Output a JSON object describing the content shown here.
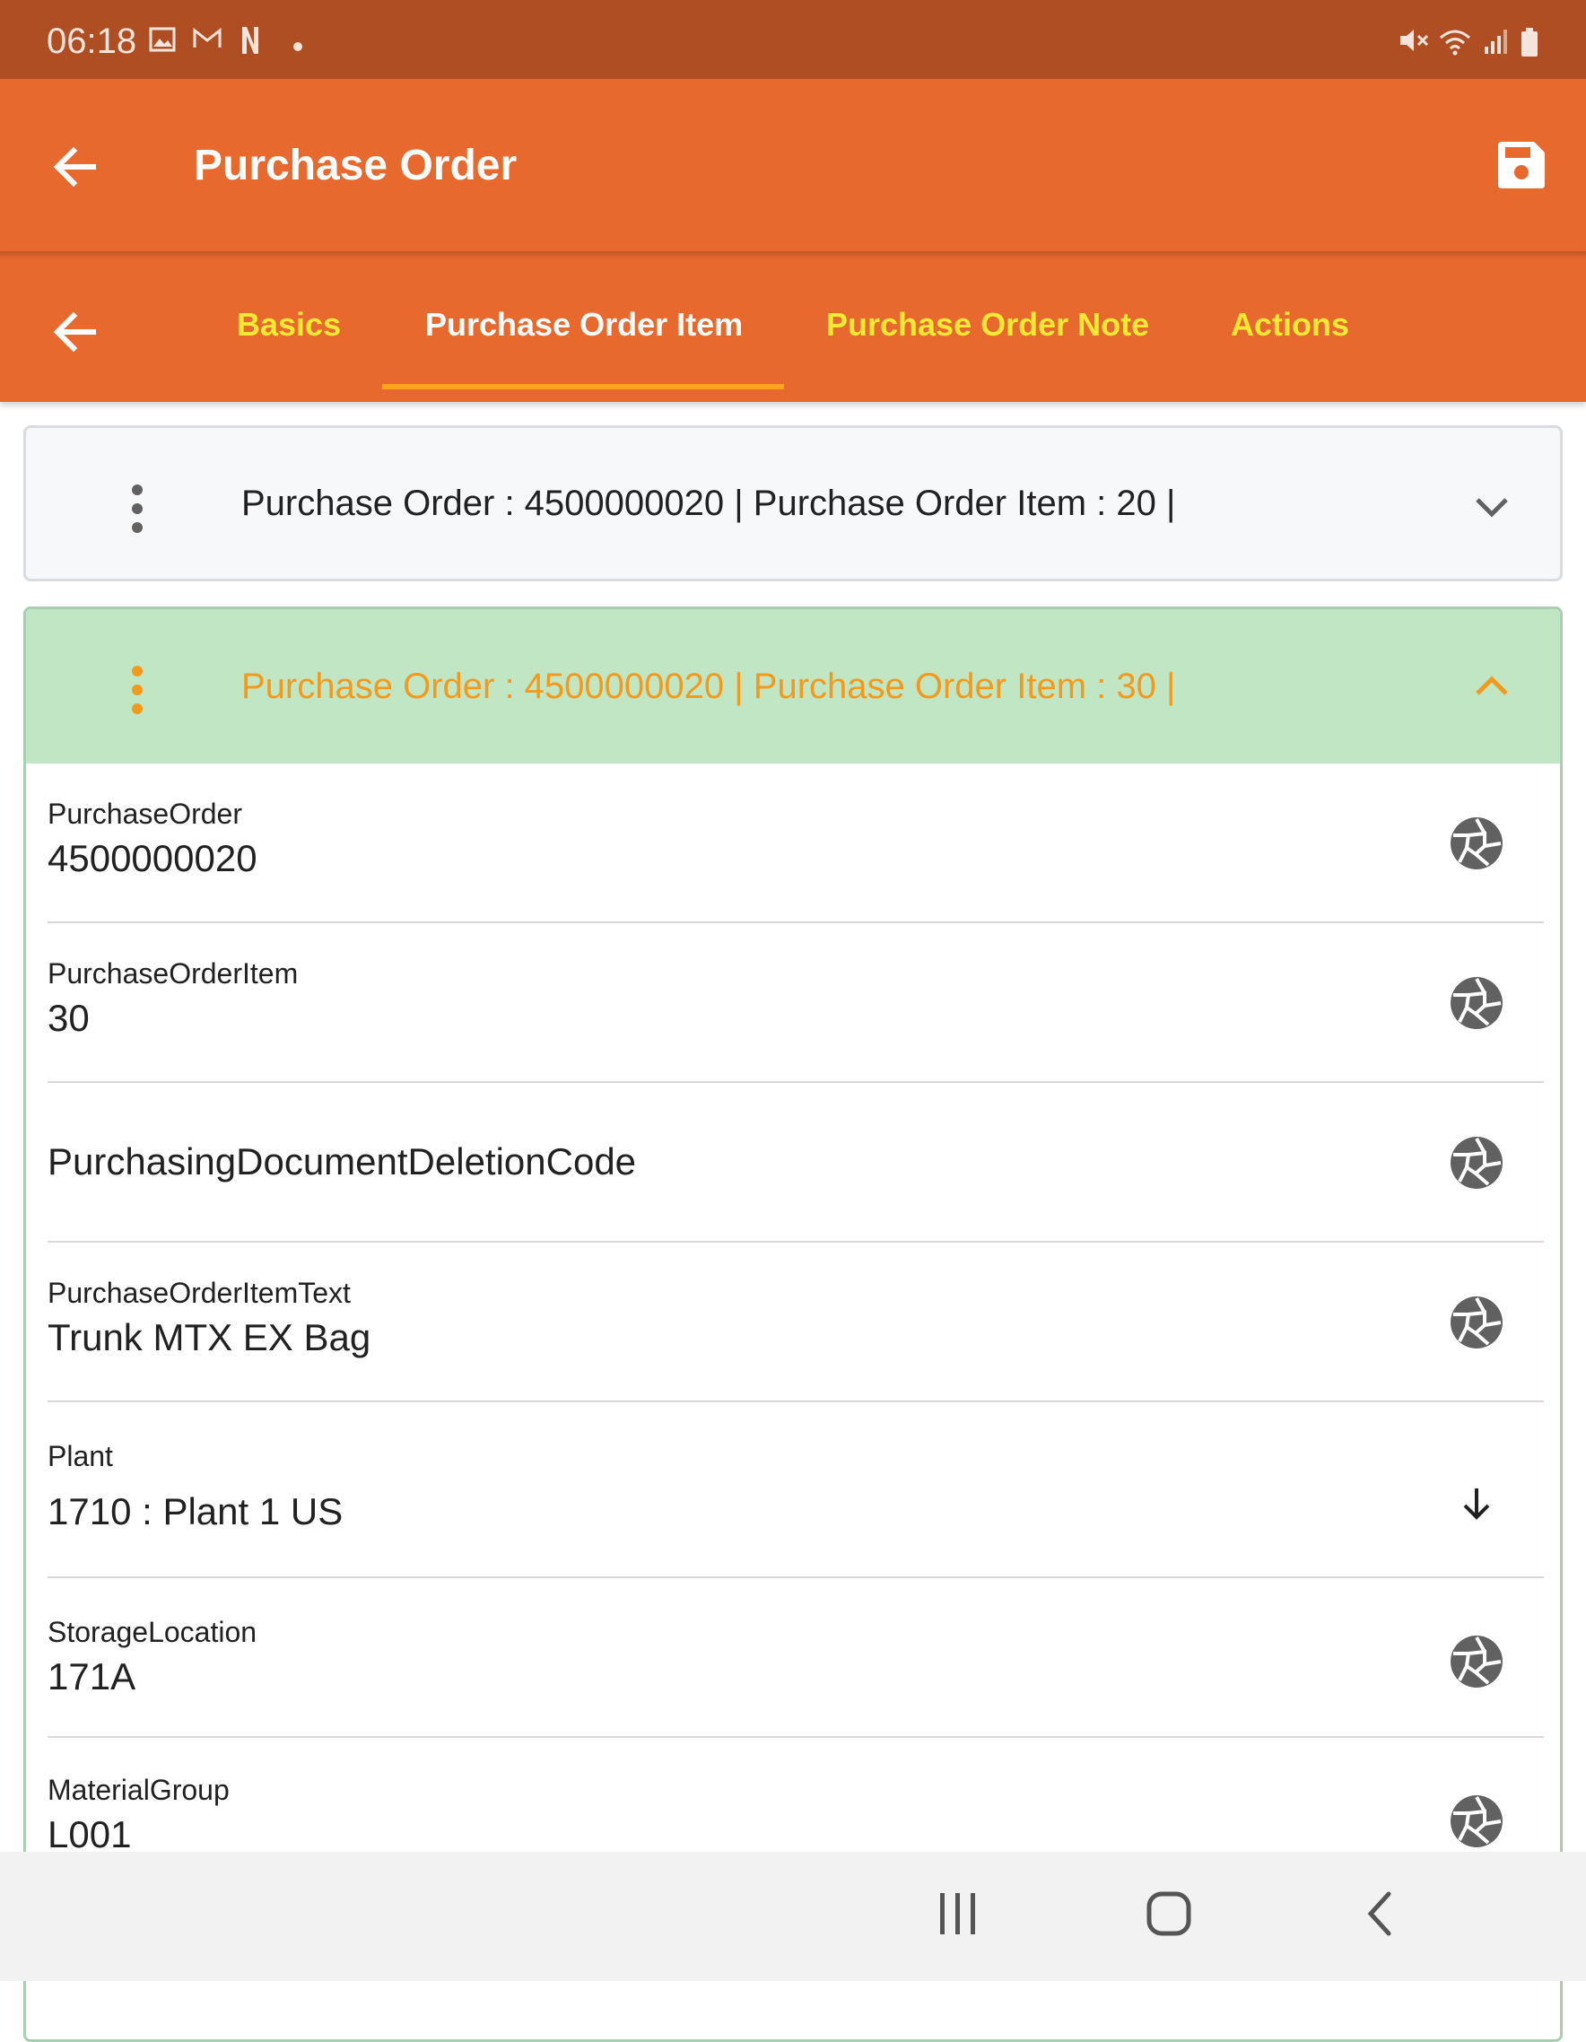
{
  "status_bar": {
    "time": "06:18",
    "left_icons": [
      "gallery-icon",
      "gmail-icon",
      "netflix-icon",
      "dot-icon"
    ],
    "right_icons": [
      "mute-icon",
      "wifi-icon",
      "signal-icon",
      "battery-icon"
    ]
  },
  "app_bar": {
    "title": "Purchase Order",
    "back_icon": "arrow-back-icon",
    "save_icon": "save-icon"
  },
  "tabs": {
    "back_icon": "arrow-back-icon",
    "items": [
      {
        "label": "Basics"
      },
      {
        "label": "Purchase Order Item"
      },
      {
        "label": "Purchase Order Note"
      },
      {
        "label": "Actions"
      }
    ],
    "active_index": 1
  },
  "items": [
    {
      "title": "Purchase Order : 4500000020 | Purchase Order Item : 20 |",
      "expanded": false
    },
    {
      "title": "Purchase Order : 4500000020 | Purchase Order Item : 30 |",
      "expanded": true,
      "fields": [
        {
          "label": "PurchaseOrder",
          "value": "4500000020",
          "icon": "aperture-icon"
        },
        {
          "label": "PurchaseOrderItem",
          "value": "30",
          "icon": "aperture-icon"
        },
        {
          "label": "PurchasingDocumentDeletionCode",
          "value": "",
          "icon": "aperture-icon"
        },
        {
          "label": "PurchaseOrderItemText",
          "value": "Trunk MTX EX Bag",
          "icon": "aperture-icon"
        },
        {
          "label": "Plant",
          "value": "1710 : Plant 1 US",
          "icon": "arrow-down-icon"
        },
        {
          "label": "StorageLocation",
          "value": "171A",
          "icon": "aperture-icon"
        },
        {
          "label": "MaterialGroup",
          "value": "L001",
          "icon": "aperture-icon"
        }
      ]
    }
  ],
  "nav_bar": {
    "buttons": [
      "recents-icon",
      "home-icon",
      "back-icon"
    ]
  },
  "colors": {
    "status_bar": "#ae4e22",
    "app_bar": "#e8692e",
    "tab_inactive": "#f5e935",
    "tab_active": "#ffffff",
    "tab_indicator": "#ffa31a",
    "expanded_header": "#c0e6c3",
    "expanded_title": "#f39a1c",
    "collapsed_bg": "#f6f8fa"
  }
}
